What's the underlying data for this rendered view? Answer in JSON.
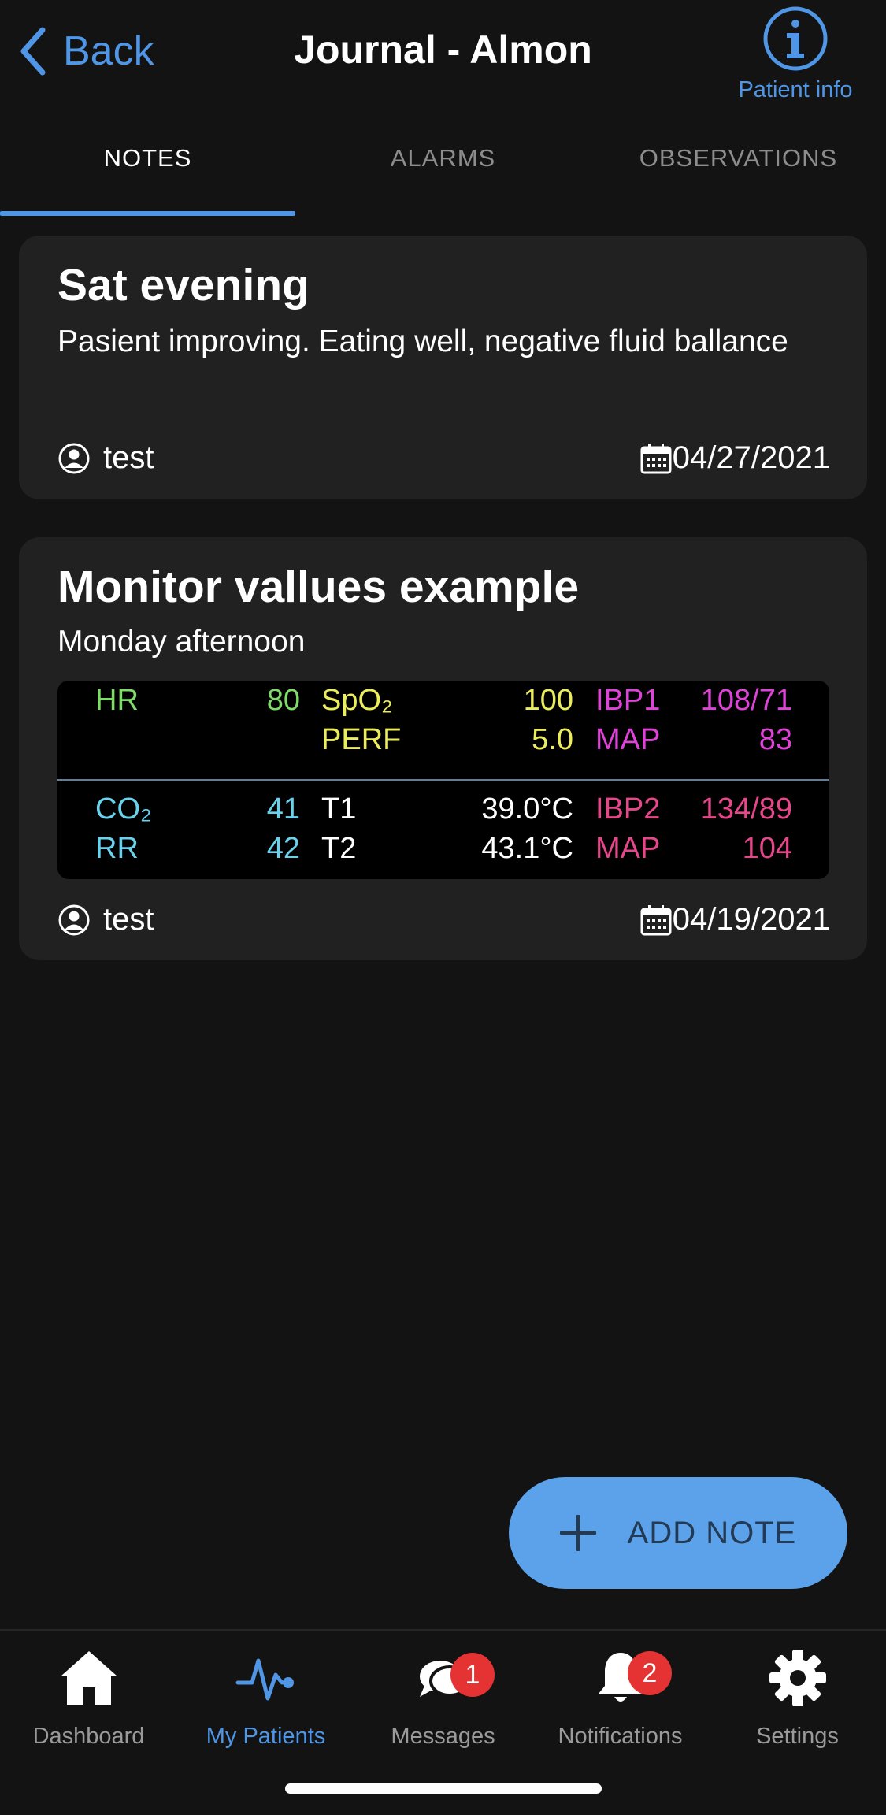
{
  "header": {
    "back_label": "Back",
    "title": "Journal - Almon",
    "patient_info_label": "Patient info"
  },
  "tabs": [
    {
      "label": "NOTES",
      "active": true
    },
    {
      "label": "ALARMS",
      "active": false
    },
    {
      "label": "OBSERVATIONS",
      "active": false
    }
  ],
  "notes": [
    {
      "title": "Sat evening",
      "text": "Pasient improving. Eating well, negative fluid ballance",
      "author": "test",
      "date": "04/27/2021"
    },
    {
      "title": "Monitor vallues example",
      "text": "Monday afternoon",
      "author": "test",
      "date": "04/19/2021",
      "monitor": {
        "hr_label": "HR",
        "hr_value": "80",
        "spo2_label": "SpO₂",
        "spo2_value": "100",
        "perf_label": "PERF",
        "perf_value": "5.0",
        "ibp1_label": "IBP1",
        "ibp1_value": "108/71",
        "map1_label": "MAP",
        "map1_value": "83",
        "co2_label": "CO₂",
        "co2_value": "41",
        "rr_label": "RR",
        "rr_value": "42",
        "t1_label": "T1",
        "t1_value": "39.0°C",
        "t2_label": "T2",
        "t2_value": "43.1°C",
        "ibp2_label": "IBP2",
        "ibp2_value": "134/89",
        "map2_label": "MAP",
        "map2_value": "104"
      }
    }
  ],
  "fab": {
    "label": "ADD NOTE"
  },
  "nav": [
    {
      "label": "Dashboard",
      "icon": "home-icon"
    },
    {
      "label": "My Patients",
      "icon": "heartbeat-icon",
      "active": true
    },
    {
      "label": "Messages",
      "icon": "chat-bubbles-icon",
      "badge": "1"
    },
    {
      "label": "Notifications",
      "icon": "bell-icon",
      "badge": "2"
    },
    {
      "label": "Settings",
      "icon": "gear-icon"
    }
  ],
  "colors": {
    "accent": "#4f96e6",
    "background": "#131313",
    "card": "#212121",
    "fab": "#5ba2ea",
    "badge": "#e53333"
  }
}
